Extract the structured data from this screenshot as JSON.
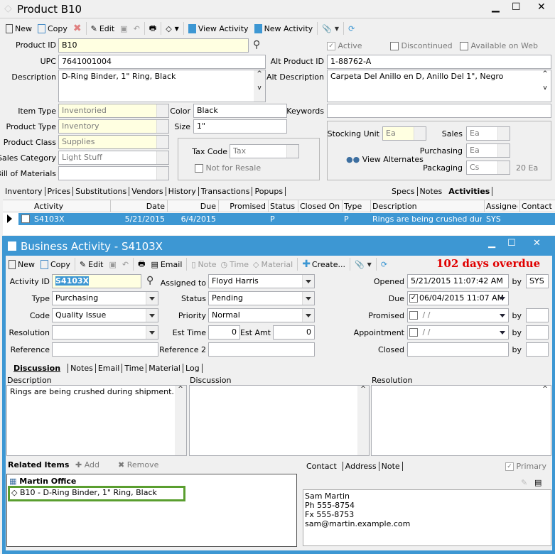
{
  "product_window": {
    "title": "Product B10",
    "toolbar": {
      "new": "New",
      "copy": "Copy",
      "edit": "Edit",
      "view_activity": "View Activity",
      "new_activity": "New Activity"
    },
    "fields": {
      "product_id_label": "Product ID",
      "product_id": "B10",
      "upc_label": "UPC",
      "upc": "7641001004",
      "description_label": "Description",
      "description": "D-Ring Binder, 1\" Ring, Black",
      "active_label": "Active",
      "discontinued_label": "Discontinued",
      "available_web_label": "Available on Web",
      "alt_product_id_label": "Alt Product ID",
      "alt_product_id": "1-88762-A",
      "alt_description_label": "Alt Description",
      "alt_description": "Carpeta Del Anillo en D, Anillo Del 1\", Negro",
      "item_type_label": "Item Type",
      "item_type": "Inventoried",
      "product_type_label": "Product Type",
      "product_type": "Inventory",
      "product_class_label": "Product Class",
      "product_class": "Supplies",
      "sales_category_label": "Sales Category",
      "sales_category": "Light Stuff",
      "bom_label": "Bill of Materials",
      "bom": "",
      "color_label": "Color",
      "color": "Black",
      "size_label": "Size",
      "size": "1\"",
      "keywords_label": "Keywords",
      "keywords": "",
      "tax_code_label": "Tax Code",
      "tax_code": "Tax",
      "not_for_resale_label": "Not for Resale",
      "stocking_unit_label": "Stocking Unit",
      "stocking_unit": "Ea",
      "sales_label": "Sales",
      "sales": "Ea",
      "purchasing_label": "Purchasing",
      "purchasing": "Ea",
      "packaging_label": "Packaging",
      "packaging": "Cs",
      "packaging_qty": "20 Ea",
      "view_alternates": "View Alternates"
    },
    "tabs_left": [
      "Inventory",
      "Prices",
      "Substitutions",
      "Vendors",
      "History",
      "Transactions",
      "Popups"
    ],
    "tabs_right": [
      "Specs",
      "Notes",
      "Activities"
    ],
    "active_tab": "Activities",
    "grid": {
      "columns": [
        "Activity",
        "Date",
        "Due",
        "Promised",
        "Status",
        "Closed On",
        "Type",
        "Description",
        "Assigned",
        "Contact"
      ],
      "rows": [
        [
          "S4103X",
          "5/21/2015",
          "6/4/2015",
          "",
          "P",
          "",
          "P",
          "Rings are being crushed during",
          "SYS",
          ""
        ]
      ]
    }
  },
  "activity_window": {
    "title": "Business Activity - S4103X",
    "overdue": "102 days overdue",
    "toolbar": {
      "new": "New",
      "copy": "Copy",
      "edit": "Edit",
      "email": "Email",
      "note": "Note",
      "time": "Time",
      "material": "Material",
      "create": "Create..."
    },
    "fields": {
      "activity_id_label": "Activity ID",
      "activity_id": "S4103X",
      "type_label": "Type",
      "type": "Purchasing",
      "code_label": "Code",
      "code": "Quality Issue",
      "resolution_label": "Resolution",
      "resolution": "",
      "reference_label": "Reference",
      "reference": "",
      "assigned_label": "Assigned to",
      "assigned": "Floyd Harris",
      "status_label": "Status",
      "status": "Pending",
      "priority_label": "Priority",
      "priority": "Normal",
      "est_time_label": "Est Time",
      "est_time": "0",
      "est_amt_label": "Est Amt",
      "est_amt": "0",
      "reference2_label": "Reference 2",
      "reference2": "",
      "opened_label": "Opened",
      "opened": "5/21/2015 11:07:42 AM",
      "opened_by": "SYS",
      "due_label": "Due",
      "due": "06/04/2015 11:07 AM",
      "promised_label": "Promised",
      "promised": " /  /",
      "promised_by": "",
      "appointment_label": "Appointment",
      "appointment": " /  /",
      "appointment_by": "",
      "closed_label": "Closed",
      "closed": "",
      "closed_by": "",
      "by_label": "by"
    },
    "tabs": [
      "Discussion",
      "Notes",
      "Email",
      "Time",
      "Material",
      "Log"
    ],
    "active_tab": "Discussion",
    "description_label": "Description",
    "description": "Rings are being crushed during shipment.",
    "discussion_label": "Discussion",
    "discussion": "",
    "resolution_label": "Resolution",
    "resolution_text": "",
    "related": {
      "title": "Related Items",
      "add": "Add",
      "remove": "Remove",
      "items": [
        "Martin Office",
        "B10 - D-Ring Binder, 1\" Ring, Black"
      ]
    },
    "contact_tabs": [
      "Contact",
      "Address",
      "Note"
    ],
    "primary_label": "Primary",
    "contact_lines": [
      "Sam Martin",
      "Ph 555-8754",
      "Fx 555-8753",
      "sam@martin.example.com"
    ]
  },
  "colors": {
    "accent": "#3d97d3",
    "overdue": "#e00000",
    "highlight": "#5a9e2f",
    "selection": "#3d97d3"
  }
}
